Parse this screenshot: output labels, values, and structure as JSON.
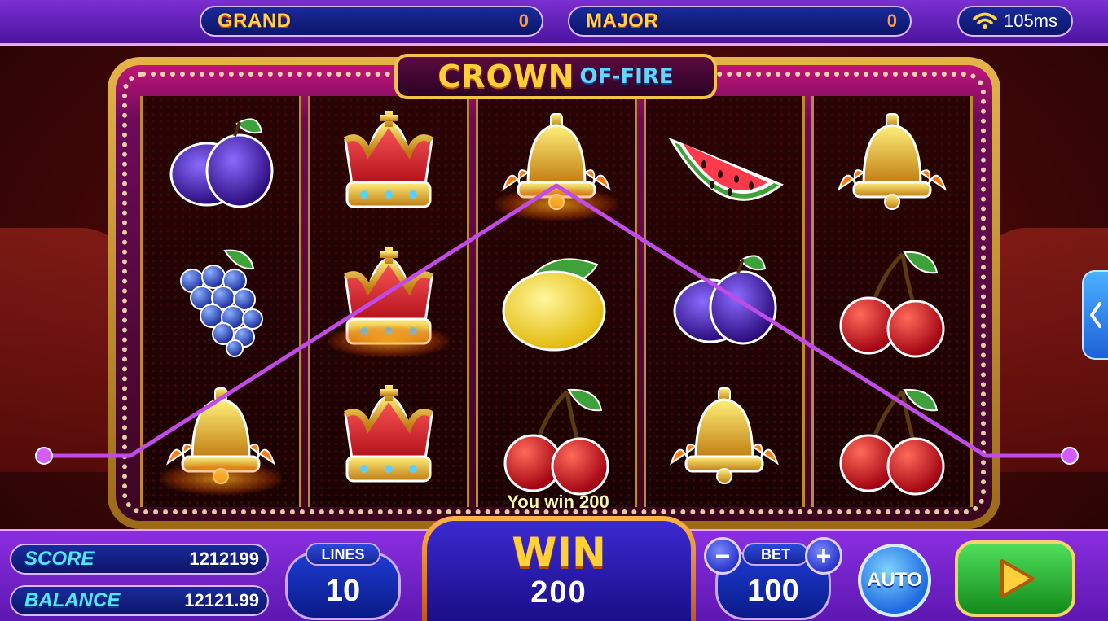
{
  "top": {
    "grand": {
      "label": "GRAND",
      "value": "0"
    },
    "major": {
      "label": "MAJOR",
      "value": "0"
    },
    "ping": "105ms"
  },
  "logo": {
    "part1": "CROWN",
    "part2": "OF-FIRE"
  },
  "reels": [
    [
      "plum",
      "grapes",
      "bell"
    ],
    [
      "crown",
      "crown",
      "crown"
    ],
    [
      "bell",
      "lemon",
      "cherry"
    ],
    [
      "watermelon",
      "plum",
      "bell"
    ],
    [
      "bell",
      "cherry",
      "cherry"
    ]
  ],
  "win_message": "You win 200",
  "bottom": {
    "score": {
      "label": "SCORE",
      "value": "1212199"
    },
    "balance": {
      "label": "BALANCE",
      "value": "12121.99"
    },
    "lines": {
      "label": "LINES",
      "value": "10"
    },
    "win": {
      "label": "WIN",
      "value": "200"
    },
    "bet": {
      "label": "BET",
      "value": "100",
      "minus": "−",
      "plus": "+"
    },
    "auto": "AUTO"
  },
  "colors": {
    "gold": "#ffd03a",
    "purple": "#5d17b0",
    "payline": "#a93bd6"
  }
}
